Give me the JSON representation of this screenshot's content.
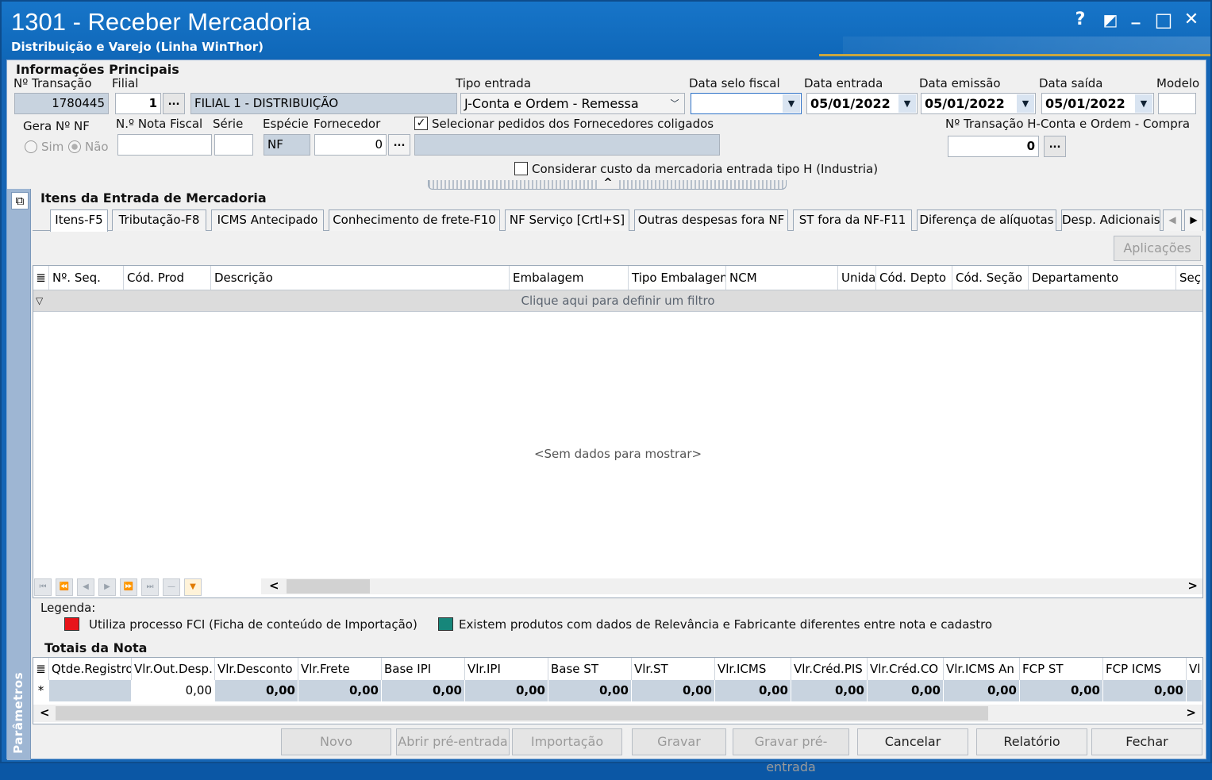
{
  "window": {
    "title": "1301 - Receber Mercadoria",
    "subtitle": "Distribuição e Varejo (Linha WinThor)",
    "help": "?",
    "restore": "◩",
    "minimize": "_",
    "maximize": "□",
    "close": "✕"
  },
  "info": {
    "section": "Informações Principais",
    "transacao_label": "Nº Transação",
    "transacao_value": "1780445",
    "filial_label": "Filial",
    "filial_code": "1",
    "filial_ellipsis": "...",
    "filial_name": "FILIAL 1 - DISTRIBUIÇÃO",
    "tipo_entrada_label": "Tipo entrada",
    "tipo_entrada_value": "J-Conta e Ordem - Remessa",
    "data_selo_label": "Data selo fiscal",
    "data_selo_value": "",
    "data_entrada_label": "Data entrada",
    "data_entrada_value": "05/01/2022",
    "data_emissao_label": "Data emissão",
    "data_emissao_value": "05/01/2022",
    "data_saida_label": "Data saída",
    "data_saida_value": "05/01/2022",
    "modelo_label": "Modelo",
    "modelo_value": "",
    "gera_nf_label": "Gera Nº NF",
    "sim": "Sim",
    "nao": "Não",
    "nota_fiscal_label": "N.º Nota Fiscal",
    "nota_fiscal_value": "",
    "serie_label": "Série",
    "serie_value": "",
    "especie_label": "Espécie",
    "especie_value": "NF",
    "fornecedor_label": "Fornecedor",
    "fornecedor_value": "0",
    "fornecedor_ellipsis": "...",
    "fornecedor_name": "",
    "coligados_label": "Selecionar pedidos dos Fornecedores coligados",
    "coligados_check": "✓",
    "transacao_h_label": "Nº Transação H-Conta e Ordem - Compra",
    "transacao_h_value": "0",
    "transacao_h_ellipsis": "...",
    "custo_label": "Considerar custo da mercadoria entrada tipo H (Industria)",
    "splitter": "^"
  },
  "sidebar": {
    "label": "Parâmetros",
    "pin": "⧉"
  },
  "itens": {
    "section": "Itens da Entrada de Mercadoria",
    "tabs": [
      "Itens-F5",
      "Tributação-F8",
      "ICMS Antecipado",
      "Conhecimento de frete-F10",
      "NF Serviço [Crtl+S]",
      "Outras despesas fora NF",
      "ST fora da NF-F11",
      "Diferença de alíquotas",
      "Desp. Adicionais"
    ],
    "tab_prev": "◀",
    "tab_next": "▶",
    "aplicacoes": "Aplicações",
    "columns": [
      "Nº. Seq.",
      "Cód. Prod",
      "Descrição",
      "Embalagem",
      "Tipo Embalagem",
      "NCM",
      "Unida",
      "Cód. Depto",
      "Cód. Seção",
      "Departamento",
      "Seç"
    ],
    "filter_text": "Clique aqui para definir um filtro",
    "empty": "<Sem dados para mostrar>",
    "nav": [
      "⏮",
      "⏪",
      "◀",
      "▶",
      "⏩",
      "⏭",
      "—",
      "▼"
    ],
    "scroll_left": "<",
    "scroll_right": ">"
  },
  "legenda": {
    "label": "Legenda:",
    "fci": "Utiliza processo FCI (Ficha de conteúdo de Importação)",
    "fci_color": "#e8141a",
    "relevancia": "Existem produtos com dados de Relevância e Fabricante diferentes entre nota e cadastro",
    "relevancia_color": "#16867a"
  },
  "totais": {
    "section": "Totais da Nota",
    "columns": [
      "Qtde.Registro",
      "Vlr.Out.Desp.",
      "Vlr.Desconto",
      "Vlr.Frete",
      "Base IPI",
      "Vlr.IPI",
      "Base ST",
      "Vlr.ST",
      "Vlr.ICMS",
      "Vlr.Créd.PIS",
      "Vlr.Créd.CO",
      "Vlr.ICMS An",
      "FCP ST",
      "FCP ICMS",
      "Vl"
    ],
    "values": [
      "",
      "0,00",
      "0,00",
      "0,00",
      "0,00",
      "0,00",
      "0,00",
      "0,00",
      "0,00",
      "0,00",
      "0,00",
      "0,00",
      "0,00",
      "0,00",
      ""
    ],
    "new_row": "*",
    "scroll_left": "<",
    "scroll_right": ">"
  },
  "buttons": {
    "novo": "Novo",
    "abrir": "Abrir pré-entrada",
    "importacao": "Importação",
    "gravar": "Gravar",
    "gravar_pre": "Gravar pré-entrada",
    "cancelar": "Cancelar",
    "relatorio": "Relatório",
    "fechar": "Fechar"
  }
}
